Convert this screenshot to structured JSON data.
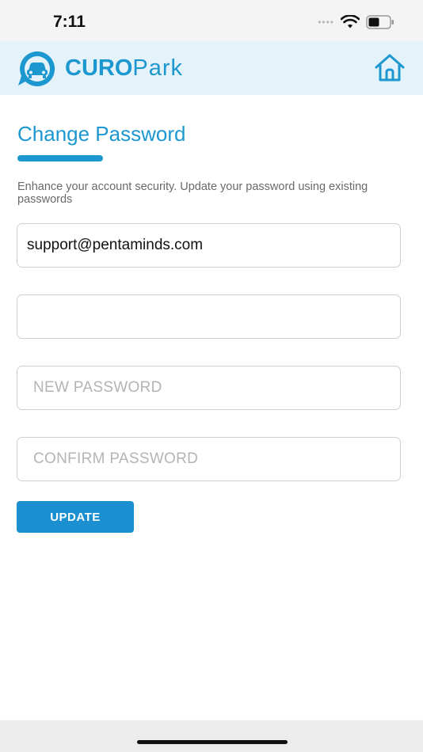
{
  "status_bar": {
    "time": "7:11"
  },
  "header": {
    "logo_bold": "CURO",
    "logo_light": "Park",
    "home_icon": "home-icon",
    "brand_color": "#1c97cf"
  },
  "form": {
    "title": "Change Password",
    "description": "Enhance your account security. Update your password using existing passwords",
    "email_value": "support@pentaminds.com",
    "old_password_value": "",
    "new_password_placeholder": "NEW PASSWORD",
    "confirm_password_placeholder": "CONFIRM PASSWORD",
    "update_label": "UPDATE"
  }
}
